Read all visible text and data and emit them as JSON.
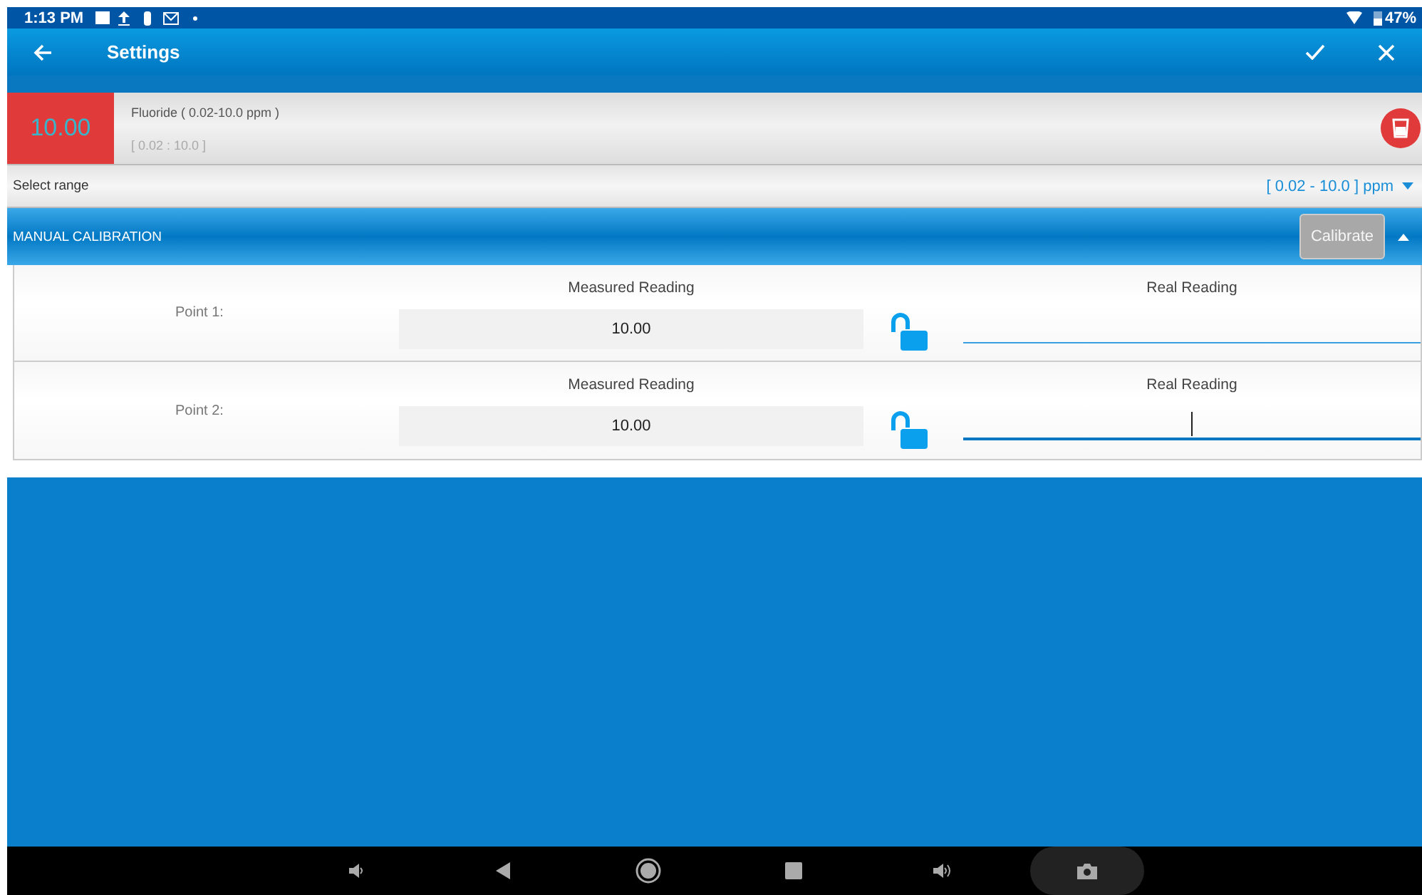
{
  "status_bar": {
    "time": "1:13 PM",
    "battery": "47%"
  },
  "app_bar": {
    "title": "Settings"
  },
  "sample": {
    "value": "10.00",
    "name": "Fluoride ( 0.02-10.0 ppm )",
    "range": "[ 0.02 : 10.0 ]"
  },
  "range_select": {
    "label": "Select range",
    "value": "[ 0.02 - 10.0 ] ppm"
  },
  "calibration": {
    "title": "MANUAL CALIBRATION",
    "button": "Calibrate",
    "button_disabled": true,
    "expanded": true,
    "points": [
      {
        "label": "Point 1:",
        "measured_label": "Measured Reading",
        "measured": "10.00",
        "locked": false,
        "real_label": "Real Reading",
        "focused": false
      },
      {
        "label": "Point 2:",
        "measured_label": "Measured Reading",
        "measured": "10.00",
        "locked": false,
        "real_label": "Real Reading",
        "focused": true
      }
    ]
  }
}
